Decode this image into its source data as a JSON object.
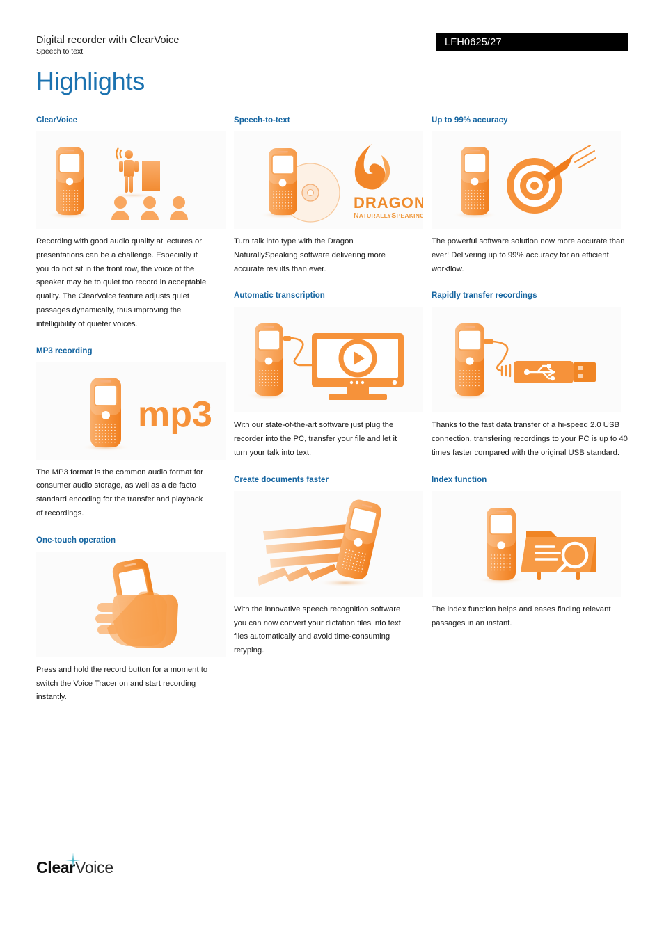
{
  "header": {
    "title": "Digital recorder with ClearVoice",
    "subtitle": "Speech to text",
    "product_code": "LFH0625/27",
    "page_title": "Highlights"
  },
  "theme": {
    "heading_blue": "#1464A0",
    "title_blue": "#1B72B0",
    "accent_orange": "#F5912F",
    "badge_bg": "#000000",
    "sparkle_cyan": "#3FB3C6"
  },
  "columns": [
    {
      "sections": [
        {
          "heading": "ClearVoice",
          "figure": "recorder-with-lecture-audience-illustration",
          "body": "Recording with good audio quality at lectures or presentations can be a challenge. Especially if you do not sit in the front row, the voice of the speaker may be to quiet too record in acceptable quality. The ClearVoice feature adjusts quiet passages dynamically, thus improving the intelligibility of quieter voices."
        },
        {
          "heading": "MP3 recording",
          "figure": "recorder-with-mp3-logo-illustration",
          "figure_label": "mp3",
          "body": "The MP3 format is the common audio format for consumer audio storage, as well as a de facto standard encoding for the transfer and playback of recordings."
        },
        {
          "heading": "One-touch operation",
          "figure": "hand-holding-recorder-illustration",
          "body": "Press and hold the record button for a moment to switch the Voice Tracer on and start recording instantly."
        }
      ]
    },
    {
      "sections": [
        {
          "heading": "Speech-to-text",
          "figure": "recorder-with-dragon-software-illustration",
          "figure_label": "DRAGON",
          "figure_sublabel": "NaturallySpeaking",
          "body": "Turn talk into type with the Dragon NaturallySpeaking software delivering more accurate results than ever."
        },
        {
          "heading": "Automatic transcription",
          "figure": "recorder-connected-to-monitor-illustration",
          "body": "With our state-of-the-art software just plug the recorder into the PC, transfer your file and let it turn your talk into text."
        },
        {
          "heading": "Create documents faster",
          "figure": "recorder-with-speed-lines-illustration",
          "body": "With the innovative speech recognition software you can now convert your dictation files into text files automatically and avoid time-consuming retyping."
        }
      ]
    },
    {
      "sections": [
        {
          "heading": "Up to 99% accuracy",
          "figure": "recorder-with-target-and-arrow-illustration",
          "body": "The powerful software solution now more accurate than ever! Delivering up to 99% accuracy for an efficient workflow."
        },
        {
          "heading": "Rapidly transfer recordings",
          "figure": "recorder-with-usb-connector-illustration",
          "body": "Thanks to the fast data transfer of a hi-speed 2.0 USB connection, transfering recordings to your PC is up to 40 times faster compared with the original USB standard."
        },
        {
          "heading": "Index function",
          "figure": "recorder-with-folder-search-illustration",
          "body": "The index function helps and eases finding relevant passages in an instant."
        }
      ]
    }
  ],
  "footer": {
    "logo_bold": "Clear",
    "logo_light": "Voice"
  }
}
